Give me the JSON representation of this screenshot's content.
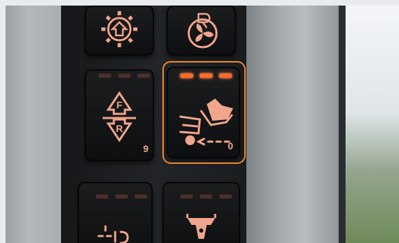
{
  "buttons": {
    "direction_counter": "9",
    "highlighted_counter": "0"
  },
  "colors": {
    "icon_glow": "#f0a58c",
    "led_on": "#ff6a2a",
    "led_off": "#4a2f2a",
    "highlight_frame": "#f28a2e"
  },
  "icons": {
    "top_left": "gear-up-arrow-icon",
    "top_right": "fan-reverse-icon",
    "mid_left": "forward-reverse-icon",
    "mid_right": "tipping-bucket-icon",
    "bottom_left": "implement-icon",
    "bottom_right": "hitch-icon"
  }
}
